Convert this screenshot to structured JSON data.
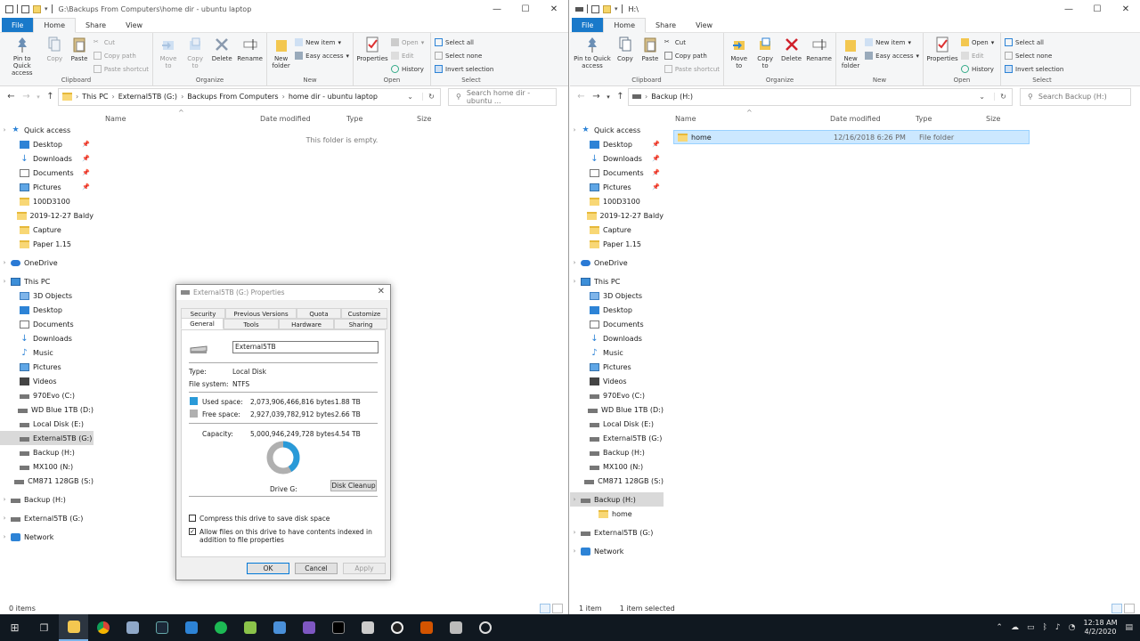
{
  "left_window": {
    "title": "G:\\Backups From Computers\\home dir - ubuntu laptop",
    "tabs": [
      "File",
      "Home",
      "Share",
      "View"
    ],
    "ribbon": {
      "clipboard": {
        "label": "Clipboard",
        "pin": "Pin to Quick access",
        "copy": "Copy",
        "paste": "Paste",
        "cut": "Cut",
        "copy_path": "Copy path",
        "paste_shortcut": "Paste shortcut"
      },
      "organize": {
        "label": "Organize",
        "move_to": "Move to",
        "copy_to": "Copy to",
        "delete": "Delete",
        "rename": "Rename"
      },
      "new": {
        "label": "New",
        "new_folder": "New folder",
        "new_item": "New item",
        "easy_access": "Easy access"
      },
      "open": {
        "label": "Open",
        "properties": "Properties",
        "open": "Open",
        "edit": "Edit",
        "history": "History"
      },
      "select": {
        "label": "Select",
        "select_all": "Select all",
        "select_none": "Select none",
        "invert": "Invert selection"
      }
    },
    "breadcrumb": [
      "This PC",
      "External5TB (G:)",
      "Backups From Computers",
      "home dir - ubuntu laptop"
    ],
    "search_placeholder": "Search home dir - ubuntu ...",
    "columns": [
      "Name",
      "Date modified",
      "Type",
      "Size"
    ],
    "empty_text": "This folder is empty.",
    "status": "0 items",
    "nav": [
      {
        "label": "Quick access",
        "icon": "star-icon",
        "type": "header"
      },
      {
        "label": "Desktop",
        "icon": "desktop-icon",
        "pin": true
      },
      {
        "label": "Downloads",
        "icon": "download-icon",
        "pin": true
      },
      {
        "label": "Documents",
        "icon": "documents-icon",
        "pin": true
      },
      {
        "label": "Pictures",
        "icon": "pictures-icon",
        "pin": true
      },
      {
        "label": "100D3100",
        "icon": "folder-icon"
      },
      {
        "label": "2019-12-27 Baldy",
        "icon": "folder-icon"
      },
      {
        "label": "Capture",
        "icon": "folder-icon"
      },
      {
        "label": "Paper 1.15",
        "icon": "folder-icon"
      },
      {
        "label": "OneDrive",
        "icon": "onedrive-icon",
        "type": "header"
      },
      {
        "label": "This PC",
        "icon": "pc-icon",
        "type": "header"
      },
      {
        "label": "3D Objects",
        "icon": "3d-objects-icon"
      },
      {
        "label": "Desktop",
        "icon": "desktop-icon"
      },
      {
        "label": "Documents",
        "icon": "documents-icon"
      },
      {
        "label": "Downloads",
        "icon": "download-icon"
      },
      {
        "label": "Music",
        "icon": "music-icon"
      },
      {
        "label": "Pictures",
        "icon": "pictures-icon"
      },
      {
        "label": "Videos",
        "icon": "videos-icon"
      },
      {
        "label": "970Evo (C:)",
        "icon": "drive-icon"
      },
      {
        "label": "WD Blue 1TB (D:)",
        "icon": "drive-icon"
      },
      {
        "label": "Local Disk (E:)",
        "icon": "drive-icon"
      },
      {
        "label": "External5TB (G:)",
        "icon": "drive-icon",
        "selected": true
      },
      {
        "label": "Backup (H:)",
        "icon": "drive-icon"
      },
      {
        "label": "MX100 (N:)",
        "icon": "drive-icon"
      },
      {
        "label": "CM871 128GB (S:)",
        "icon": "drive-icon"
      },
      {
        "label": "Backup (H:)",
        "icon": "drive-icon",
        "type": "header"
      },
      {
        "label": "External5TB (G:)",
        "icon": "drive-icon",
        "type": "header"
      },
      {
        "label": "Network",
        "icon": "network-icon",
        "type": "header"
      }
    ]
  },
  "right_window": {
    "title": "H:\\",
    "tabs": [
      "File",
      "Home",
      "Share",
      "View"
    ],
    "ribbon": {
      "clipboard": {
        "label": "Clipboard",
        "pin": "Pin to Quick access",
        "copy": "Copy",
        "paste": "Paste",
        "cut": "Cut",
        "copy_path": "Copy path",
        "paste_shortcut": "Paste shortcut"
      },
      "organize": {
        "label": "Organize",
        "move_to": "Move to",
        "copy_to": "Copy to",
        "delete": "Delete",
        "rename": "Rename"
      },
      "new": {
        "label": "New",
        "new_folder": "New folder",
        "new_item": "New item",
        "easy_access": "Easy access"
      },
      "open": {
        "label": "Open",
        "properties": "Properties",
        "open": "Open",
        "edit": "Edit",
        "history": "History"
      },
      "select": {
        "label": "Select",
        "select_all": "Select all",
        "select_none": "Select none",
        "invert": "Invert selection"
      }
    },
    "breadcrumb": [
      "Backup (H:)"
    ],
    "search_placeholder": "Search Backup (H:)",
    "columns": [
      "Name",
      "Date modified",
      "Type",
      "Size"
    ],
    "files": [
      {
        "name": "home",
        "date": "12/16/2018 6:26 PM",
        "type": "File folder",
        "size": ""
      }
    ],
    "status_items": "1 item",
    "status_selected": "1 item selected",
    "nav": [
      {
        "label": "Quick access",
        "icon": "star-icon",
        "type": "header"
      },
      {
        "label": "Desktop",
        "icon": "desktop-icon",
        "pin": true
      },
      {
        "label": "Downloads",
        "icon": "download-icon",
        "pin": true
      },
      {
        "label": "Documents",
        "icon": "documents-icon",
        "pin": true
      },
      {
        "label": "Pictures",
        "icon": "pictures-icon",
        "pin": true
      },
      {
        "label": "100D3100",
        "icon": "folder-icon"
      },
      {
        "label": "2019-12-27 Baldy",
        "icon": "folder-icon"
      },
      {
        "label": "Capture",
        "icon": "folder-icon"
      },
      {
        "label": "Paper 1.15",
        "icon": "folder-icon"
      },
      {
        "label": "OneDrive",
        "icon": "onedrive-icon",
        "type": "header"
      },
      {
        "label": "This PC",
        "icon": "pc-icon",
        "type": "header"
      },
      {
        "label": "3D Objects",
        "icon": "3d-objects-icon"
      },
      {
        "label": "Desktop",
        "icon": "desktop-icon"
      },
      {
        "label": "Documents",
        "icon": "documents-icon"
      },
      {
        "label": "Downloads",
        "icon": "download-icon"
      },
      {
        "label": "Music",
        "icon": "music-icon"
      },
      {
        "label": "Pictures",
        "icon": "pictures-icon"
      },
      {
        "label": "Videos",
        "icon": "videos-icon"
      },
      {
        "label": "970Evo (C:)",
        "icon": "drive-icon"
      },
      {
        "label": "WD Blue 1TB (D:)",
        "icon": "drive-icon"
      },
      {
        "label": "Local Disk (E:)",
        "icon": "drive-icon"
      },
      {
        "label": "External5TB (G:)",
        "icon": "drive-icon"
      },
      {
        "label": "Backup (H:)",
        "icon": "drive-icon"
      },
      {
        "label": "MX100 (N:)",
        "icon": "drive-icon"
      },
      {
        "label": "CM871 128GB (S:)",
        "icon": "drive-icon"
      },
      {
        "label": "Backup (H:)",
        "icon": "drive-icon",
        "type": "header",
        "selected": true
      },
      {
        "label": "home",
        "icon": "folder-icon",
        "type": "child"
      },
      {
        "label": "External5TB (G:)",
        "icon": "drive-icon",
        "type": "header"
      },
      {
        "label": "Network",
        "icon": "network-icon",
        "type": "header"
      }
    ]
  },
  "properties_dialog": {
    "title": "External5TB (G:) Properties",
    "tabs_row1": [
      "Security",
      "Previous Versions",
      "Quota",
      "Customize"
    ],
    "tabs_row2": [
      "General",
      "Tools",
      "Hardware",
      "Sharing"
    ],
    "name_value": "External5TB",
    "type_label": "Type:",
    "type_value": "Local Disk",
    "fs_label": "File system:",
    "fs_value": "NTFS",
    "used_label": "Used space:",
    "used_bytes": "2,073,906,466,816 bytes",
    "used_human": "1.88 TB",
    "free_label": "Free space:",
    "free_bytes": "2,927,039,782,912 bytes",
    "free_human": "2.66 TB",
    "capacity_label": "Capacity:",
    "capacity_bytes": "5,000,946,249,728 bytes",
    "capacity_human": "4.54 TB",
    "used_fraction": 0.4147,
    "drive_label": "Drive G:",
    "disk_cleanup": "Disk Cleanup",
    "compress_label": "Compress this drive to save disk space",
    "compress_checked": false,
    "index_label": "Allow files on this drive to have contents indexed in addition to file properties",
    "index_checked": true,
    "ok": "OK",
    "cancel": "Cancel",
    "apply": "Apply",
    "colors": {
      "used": "#2a9ad8",
      "free": "#b0b0b0"
    }
  },
  "taskbar": {
    "time": "12:18 AM",
    "date": "4/2/2020",
    "apps": [
      "start-icon",
      "task-view-icon",
      "file-explorer-icon",
      "chrome-icon",
      "app-icon",
      "steam-icon",
      "mail-icon",
      "spotify-icon",
      "app-icon",
      "app-icon",
      "app-icon",
      "terminal-icon",
      "app-icon",
      "app-icon",
      "app-icon",
      "app-icon",
      "app-icon"
    ]
  },
  "colors": {
    "file_tab": "#1979ca",
    "selection": "#cce8ff",
    "taskbar": "#101820"
  }
}
